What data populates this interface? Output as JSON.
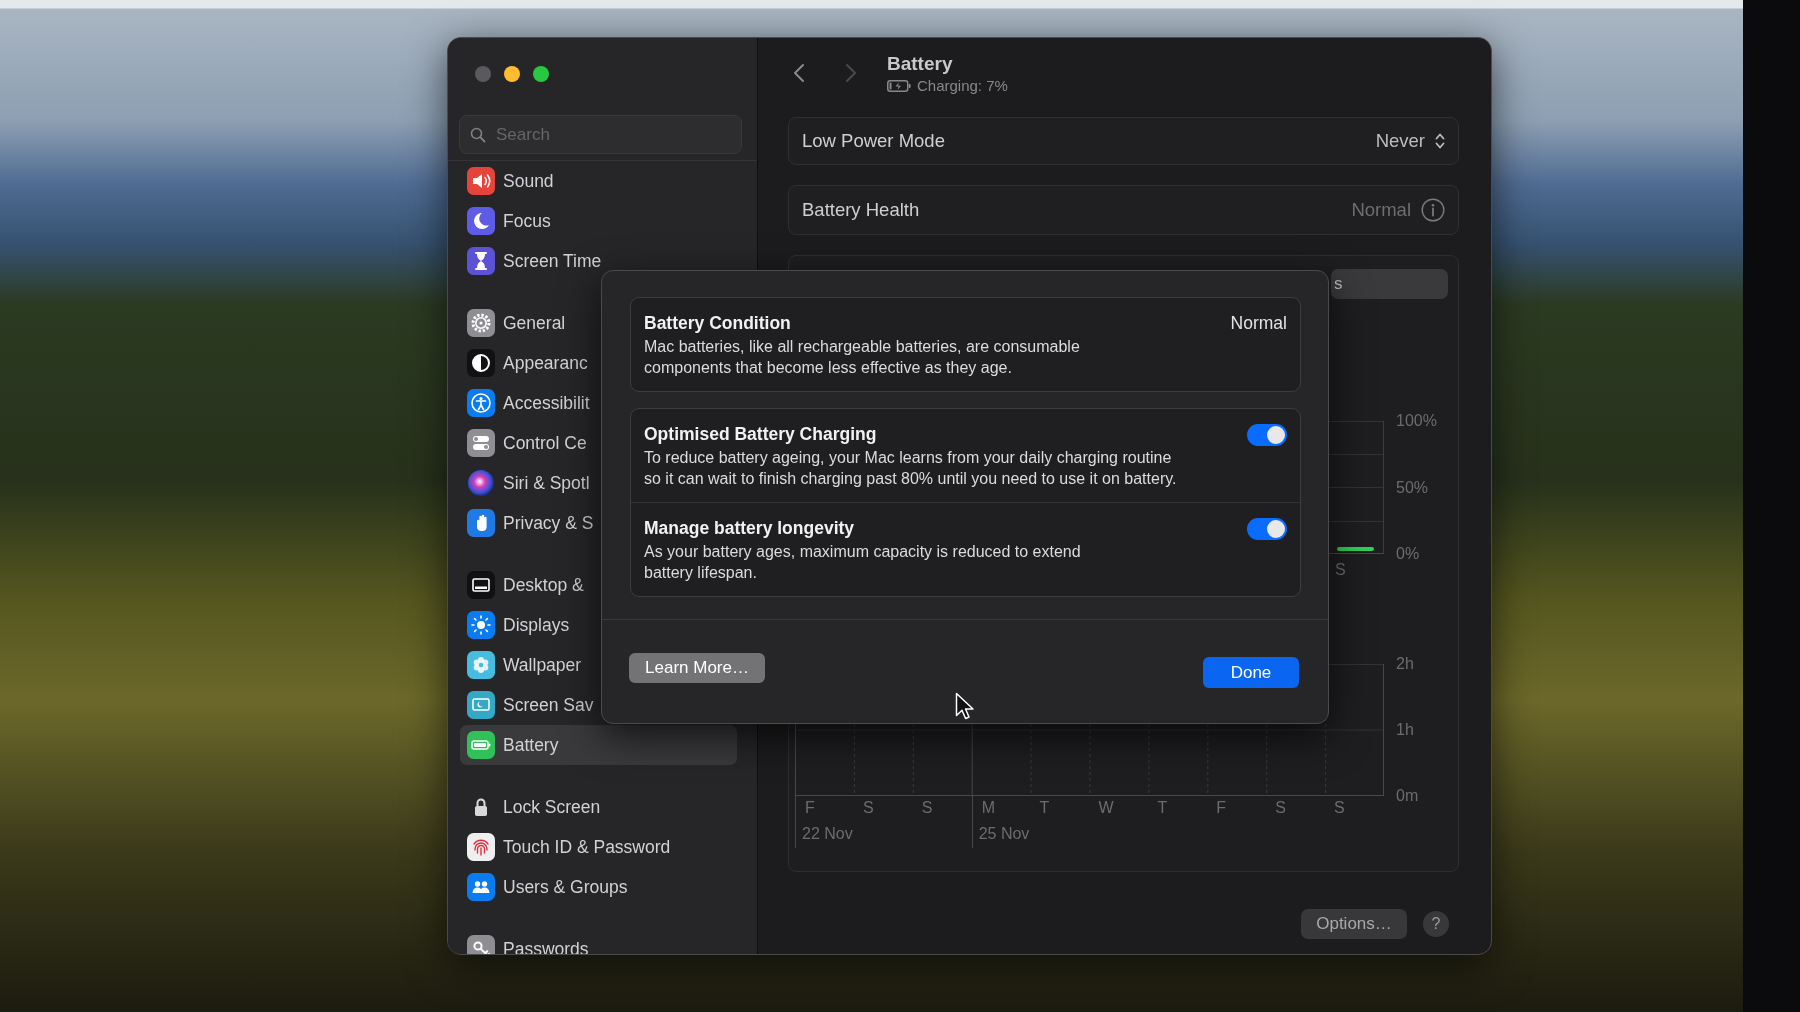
{
  "window": {
    "traffic_lights": [
      {
        "kind": "close",
        "disabled": true
      },
      {
        "kind": "minimize",
        "disabled": false
      },
      {
        "kind": "zoom",
        "disabled": false
      }
    ]
  },
  "sidebar": {
    "search": {
      "placeholder": "Search"
    },
    "groups": [
      {
        "items": [
          {
            "label": "Sound",
            "selected": false
          },
          {
            "label": "Focus",
            "selected": false
          },
          {
            "label": "Screen Time",
            "selected": false
          }
        ]
      },
      {
        "items": [
          {
            "label": "General",
            "selected": false
          },
          {
            "label": "Appearanc",
            "selected": false
          },
          {
            "label": "Accessibilit",
            "selected": false
          },
          {
            "label": "Control Ce",
            "selected": false
          },
          {
            "label": "Siri & Spotl",
            "selected": false
          },
          {
            "label": "Privacy & S",
            "selected": false
          }
        ]
      },
      {
        "items": [
          {
            "label": "Desktop &",
            "selected": false
          },
          {
            "label": "Displays",
            "selected": false
          },
          {
            "label": "Wallpaper",
            "selected": false
          },
          {
            "label": "Screen Sav",
            "selected": false
          },
          {
            "label": "Battery",
            "selected": true
          }
        ]
      },
      {
        "items": [
          {
            "label": "Lock Screen",
            "selected": false
          },
          {
            "label": "Touch ID & Password",
            "selected": false
          },
          {
            "label": "Users & Groups",
            "selected": false
          }
        ]
      },
      {
        "items": [
          {
            "label": "Passwords",
            "selected": false
          }
        ]
      }
    ]
  },
  "header": {
    "nav_buttons": [
      {
        "kind": "back",
        "disabled": false
      },
      {
        "kind": "forward",
        "disabled": true
      }
    ],
    "title": "Battery",
    "subtitle": "Charging: 7%"
  },
  "settings_rows": [
    {
      "kind": "popup",
      "label": "Low Power Mode",
      "value": "Never"
    },
    {
      "kind": "info",
      "label": "Battery Health",
      "value": "Normal"
    }
  ],
  "usage_panel": {
    "segments": [
      {
        "label": "s",
        "selected": true
      }
    ],
    "level_chart": {
      "y_labels": [
        "100%",
        "50%",
        "0%"
      ],
      "x_labels": [
        "S"
      ]
    },
    "usage_chart": {
      "y_labels": [
        "2h",
        "1h",
        "0m"
      ],
      "days": [
        {
          "label": "F",
          "date": "22 Nov"
        },
        {
          "label": "S"
        },
        {
          "label": "S"
        },
        {
          "label": "M",
          "date": "25 Nov"
        },
        {
          "label": "T"
        },
        {
          "label": "W"
        },
        {
          "label": "T"
        },
        {
          "label": "F"
        },
        {
          "label": "S"
        },
        {
          "label": "S"
        }
      ]
    }
  },
  "footer": {
    "options_button": "Options…",
    "help_button": "?"
  },
  "dialog": {
    "sections": [
      {
        "rows": [
          {
            "kind": "status",
            "title": "Battery Condition",
            "description": "Mac batteries, like all rechargeable batteries, are consumable components that become less effective as they age.",
            "value": "Normal"
          }
        ]
      },
      {
        "rows": [
          {
            "kind": "toggle",
            "title": "Optimised Battery Charging",
            "description": "To reduce battery ageing, your Mac learns from your daily charging routine so it can wait to finish charging past 80% until you need to use it on battery.",
            "on": true
          },
          {
            "kind": "toggle",
            "title": "Manage battery longevity",
            "description": "As your battery ages, maximum capacity is reduced to extend battery lifespan.",
            "on": true
          }
        ]
      }
    ],
    "buttons": [
      {
        "kind": "secondary",
        "label": "Learn More…"
      },
      {
        "kind": "primary",
        "label": "Done"
      }
    ]
  }
}
